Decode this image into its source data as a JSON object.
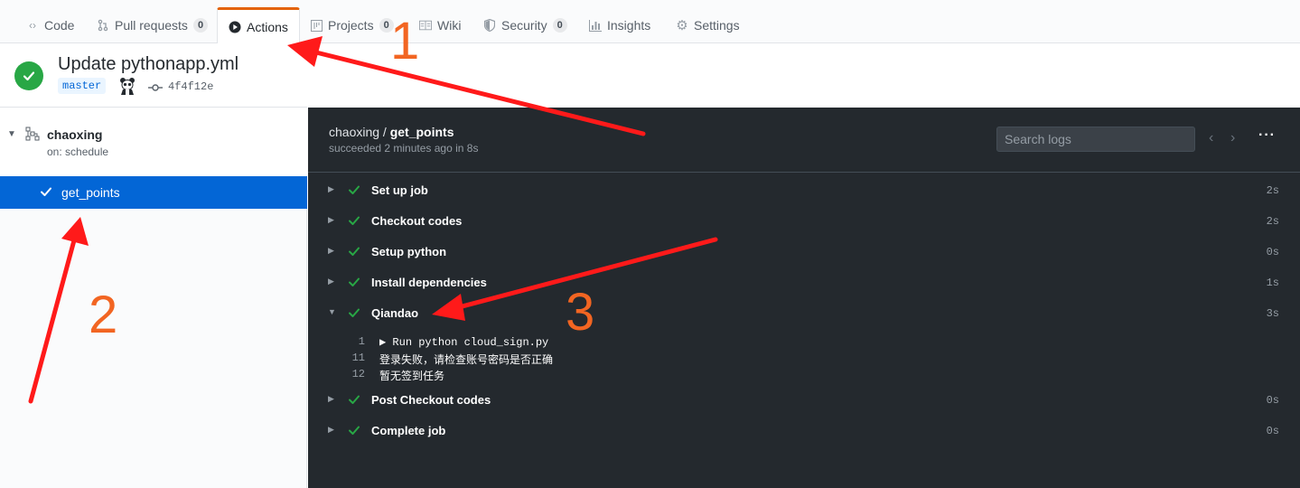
{
  "tabs": [
    {
      "label": "Code",
      "icon": "code-icon"
    },
    {
      "label": "Pull requests",
      "icon": "pull-request-icon",
      "count": "0"
    },
    {
      "label": "Actions",
      "icon": "play-icon",
      "active": true
    },
    {
      "label": "Projects",
      "icon": "project-icon",
      "count": "0"
    },
    {
      "label": "Wiki",
      "icon": "book-icon"
    },
    {
      "label": "Security",
      "icon": "shield-icon",
      "count": "0"
    },
    {
      "label": "Insights",
      "icon": "graph-icon"
    },
    {
      "label": "Settings",
      "icon": "gear-icon"
    }
  ],
  "run": {
    "title": "Update pythonapp.yml",
    "branch": "master",
    "sha": "4f4f12e"
  },
  "sidebar": {
    "workflow": {
      "name": "chaoxing",
      "trigger": "on: schedule"
    },
    "job": {
      "name": "get_points"
    }
  },
  "log": {
    "repo": "chaoxing / ",
    "job": "get_points",
    "status": "succeeded 2 minutes ago in 8s",
    "search_placeholder": "Search logs",
    "steps": [
      {
        "name": "Set up job",
        "duration": "2s"
      },
      {
        "name": "Checkout codes",
        "duration": "2s"
      },
      {
        "name": "Setup python",
        "duration": "0s"
      },
      {
        "name": "Install dependencies",
        "duration": "1s"
      },
      {
        "name": "Qiandao",
        "duration": "3s",
        "expanded": true
      },
      {
        "name": "Post Checkout codes",
        "duration": "0s"
      },
      {
        "name": "Complete job",
        "duration": "0s"
      }
    ],
    "lines": [
      {
        "num": "1",
        "text": "▶ Run python cloud_sign.py"
      },
      {
        "num": "11",
        "text": "登录失败，请检查账号密码是否正确"
      },
      {
        "num": "12",
        "text": "暂无签到任务"
      }
    ]
  },
  "annotations": [
    "1",
    "2",
    "3"
  ],
  "colors": {
    "accent": "#f26522",
    "success": "#28a745",
    "selected": "#0366d6",
    "arrow": "#ff0000"
  }
}
